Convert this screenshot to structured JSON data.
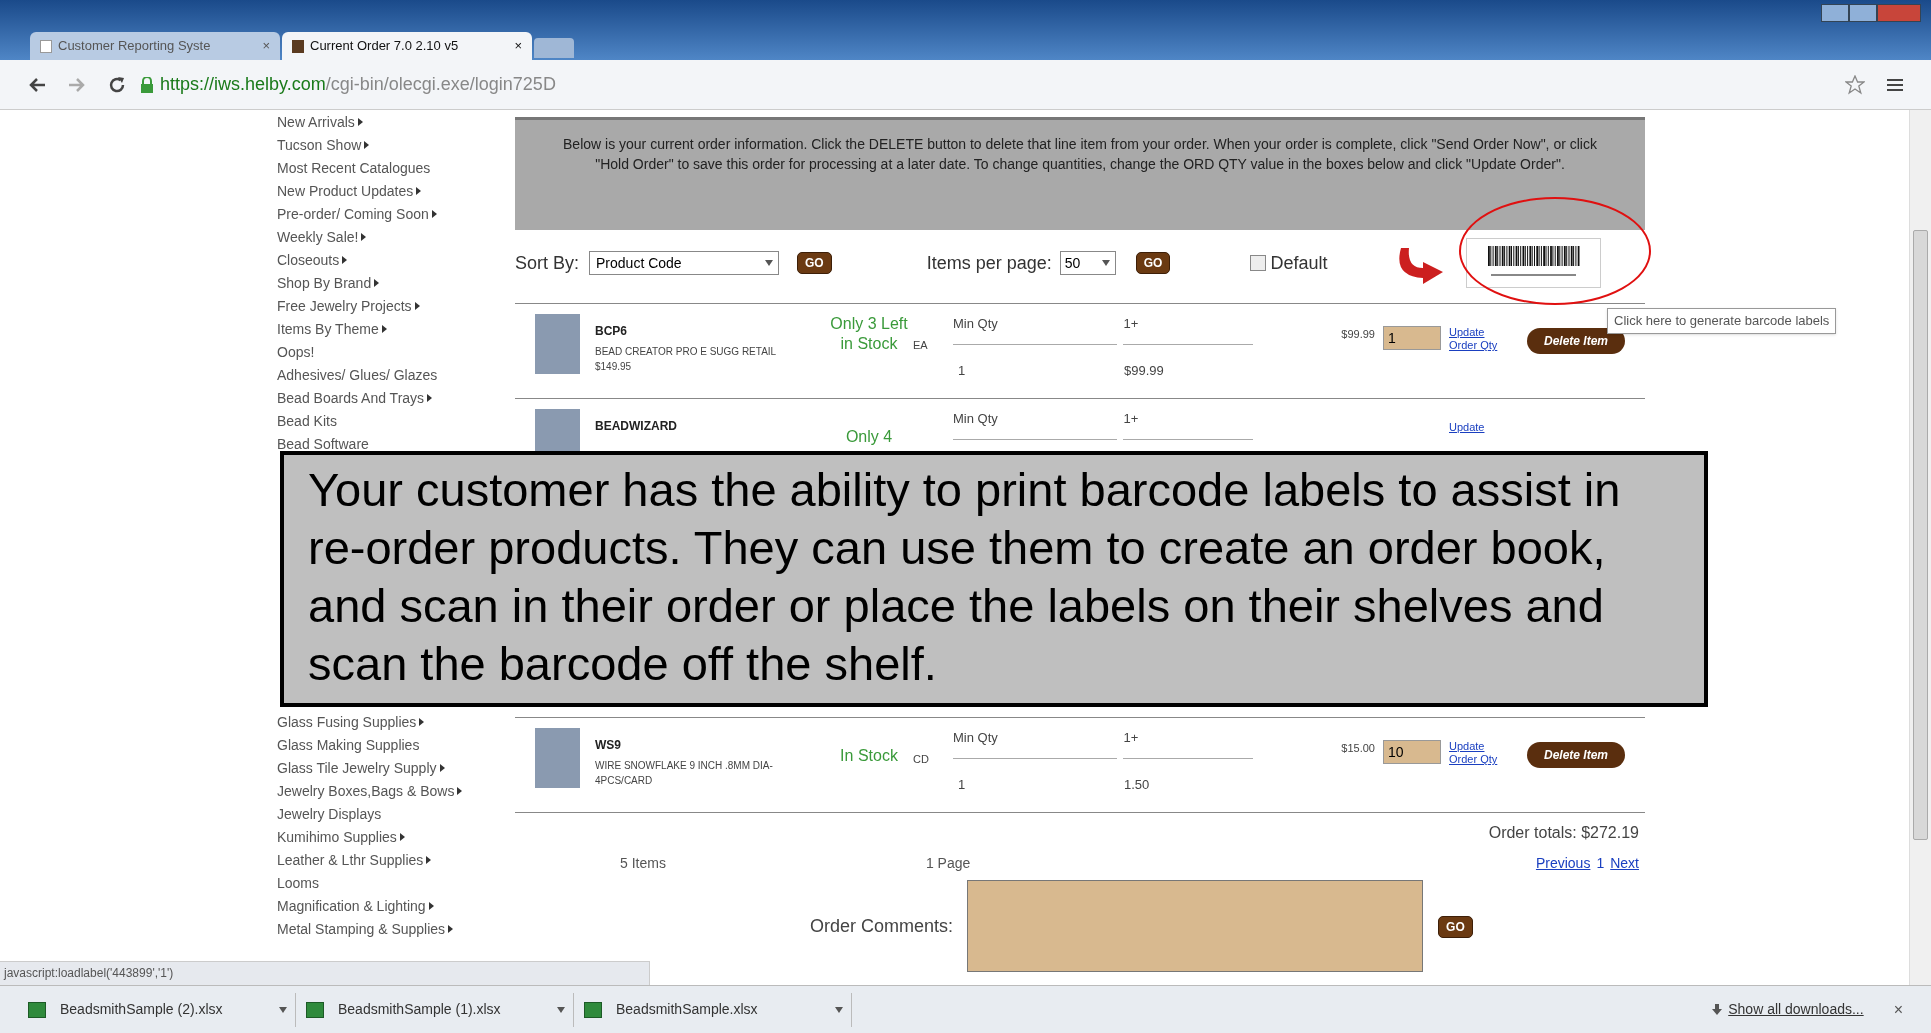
{
  "browser": {
    "tabs": [
      {
        "title": "Customer Reporting Syste",
        "close": "×",
        "selected": false
      },
      {
        "title": "Current Order 7.0 2.10 v5",
        "close": "×",
        "selected": true
      }
    ],
    "url_host": "https://iws.helby.com",
    "url_path": "/cgi-bin/olecgi.exe/login725D"
  },
  "sidebar": {
    "groups": [
      [
        {
          "label": "New Arrivals",
          "submenu": true
        },
        {
          "label": "Tucson Show",
          "submenu": true
        },
        {
          "label": "Most Recent Catalogues",
          "submenu": false
        },
        {
          "label": "New Product Updates",
          "submenu": true
        },
        {
          "label": "Pre-order/ Coming Soon",
          "submenu": true
        },
        {
          "label": "Weekly Sale!",
          "submenu": true
        },
        {
          "label": "Closeouts",
          "submenu": true
        },
        {
          "label": "Shop By Brand",
          "submenu": true
        },
        {
          "label": "Free Jewelry Projects",
          "submenu": true
        },
        {
          "label": "Items By Theme",
          "submenu": true
        },
        {
          "label": "Oops!",
          "submenu": false
        },
        {
          "label": "Adhesives/ Glues/ Glazes",
          "submenu": false
        },
        {
          "label": "Bead Boards And Trays",
          "submenu": true
        },
        {
          "label": "Bead Kits",
          "submenu": false
        },
        {
          "label": "Bead Software",
          "submenu": false
        }
      ],
      [
        {
          "label": "Glass Fusing Supplies",
          "submenu": true
        },
        {
          "label": "Glass Making Supplies",
          "submenu": false
        },
        {
          "label": "Glass Tile Jewelry Supply",
          "submenu": true
        },
        {
          "label": "Jewelry Boxes,Bags & Bows",
          "submenu": true
        },
        {
          "label": "Jewelry Displays",
          "submenu": false
        },
        {
          "label": "Kumihimo Supplies",
          "submenu": true
        },
        {
          "label": "Leather & Lthr Supplies",
          "submenu": true
        },
        {
          "label": "Looms",
          "submenu": false
        },
        {
          "label": "Magnification & Lighting",
          "submenu": true
        },
        {
          "label": "Metal Stamping & Supplies",
          "submenu": true
        }
      ]
    ]
  },
  "instructions": "Below is your current order information. Click the DELETE button to delete that line item from your order. When your order is complete, click \"Send Order Now\", or click \"Hold Order\" to save this order for processing at a later date. To change quantities, change the ORD QTY value in the boxes below and click \"Update Order\".",
  "sort": {
    "label": "Sort By:",
    "value": "Product Code",
    "go": "GO"
  },
  "per_page": {
    "label": "Items per page:",
    "value": "50",
    "go": "GO"
  },
  "default_option": {
    "label": "Default",
    "checked": false
  },
  "barcode_tooltip": "Click here to generate barcode labels",
  "items": [
    {
      "code": "BCP6",
      "description": "BEAD CREATOR PRO E SUGG RETAIL $149.95",
      "stock": "Only 3 Left in Stock",
      "unit": "EA",
      "min_label": "Min Qty",
      "min_value": "1+",
      "tier_qty": "1",
      "tier_price": "$99.99",
      "price": "$99.99",
      "qty": "1",
      "update": "Update Order Qty",
      "delete": "Delete Item"
    },
    {
      "code": "BEADWIZARD",
      "stock": "Only 4",
      "min_label": "Min Qty",
      "min_value": "1+",
      "update": "Update"
    },
    {
      "code": "WS9",
      "description": "WIRE SNOWFLAKE 9 INCH .8MM DIA- 4PCS/CARD",
      "stock": "In Stock",
      "unit": "CD",
      "min_label": "Min Qty",
      "min_value": "1+",
      "tier_qty": "1",
      "tier_price": "1.50",
      "price": "$15.00",
      "qty": "10",
      "update": "Update Order Qty",
      "delete": "Delete Item"
    }
  ],
  "order_totals": "Order totals: $272.19",
  "item_count": "5 Items",
  "page_count": "1 Page",
  "pager": {
    "previous": "Previous",
    "page": "1",
    "next": "Next"
  },
  "comments": {
    "label": "Order Comments:",
    "go": "GO"
  },
  "callout": "Your customer has the ability to print barcode labels to assist in re-order products. They can use them to create an order book, and scan in their order or place the labels on their shelves and scan the barcode off the shelf.",
  "status_url": "javascript:loadlabel('443899','1')",
  "downloads": {
    "files": [
      {
        "name": "BeadsmithSample (2).xlsx"
      },
      {
        "name": "BeadsmithSample (1).xlsx"
      },
      {
        "name": "BeadsmithSample.xlsx"
      }
    ],
    "show_all": "Show all downloads...",
    "close": "×"
  }
}
